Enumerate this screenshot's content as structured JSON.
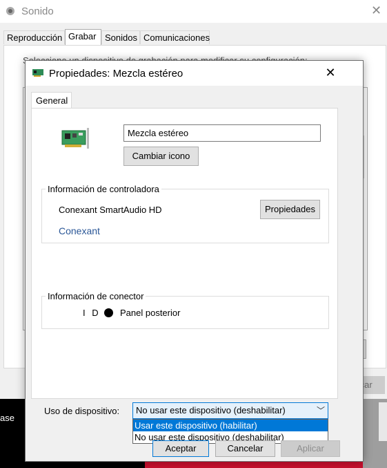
{
  "background_window": {
    "title": "Sonido",
    "tabs": [
      "Reproducción",
      "Grabar",
      "Sonidos",
      "Comunicaciones"
    ],
    "selected_tab": "Grabar",
    "instruction": "Seleccione un dispositivo de grabación para modificar su configuración:",
    "properties_button": "ades",
    "apply_button": "Aplicar",
    "behind_text": "ase"
  },
  "dialog": {
    "title": "Propiedades: Mezcla estéreo",
    "tab": "General",
    "device_name": "Mezcla estéreo",
    "change_icon_button": "Cambiar icono",
    "controller_group": {
      "label": "Información de controladora",
      "name": "Conexant SmartAudio HD",
      "properties_button": "Propiedades",
      "link": "Conexant"
    },
    "connector_group": {
      "label": "Información de conector",
      "id": "I D",
      "location": "Panel posterior"
    },
    "usage": {
      "label": "Uso de dispositivo:",
      "selected": "No usar este dispositivo (deshabilitar)",
      "options": [
        "Usar este dispositivo (habilitar)",
        "No usar este dispositivo (deshabilitar)"
      ],
      "highlighted_index": 0
    },
    "buttons": {
      "ok": "Aceptar",
      "cancel": "Cancelar",
      "apply": "Aplicar"
    }
  },
  "colors": {
    "accent": "#0078d7",
    "link": "#2b5797",
    "highlight_text": "#ffffff"
  }
}
